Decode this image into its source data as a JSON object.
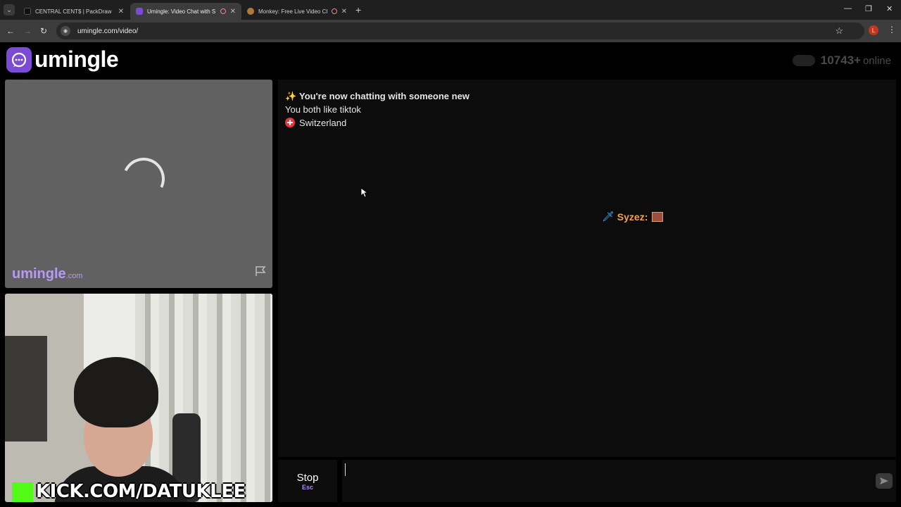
{
  "browser": {
    "tabs": [
      {
        "title": "CENTRAL CENT$ | PackDraw",
        "active": false
      },
      {
        "title": "Umingle: Video Chat with S",
        "active": true
      },
      {
        "title": "Monkey: Free Live Video Ch",
        "active": false
      }
    ],
    "url": "umingle.com/video/",
    "profile_initial": "L"
  },
  "header": {
    "brand": "umingle",
    "online_count": "10743+",
    "online_label": "online"
  },
  "stranger_video": {
    "watermark_main": "umingle",
    "watermark_suffix": ".com"
  },
  "self_video": {
    "overlay_text": "KICK.COM/DATUKLEE"
  },
  "chat": {
    "system_lines": [
      {
        "icon": "✨",
        "text": "You're now chatting with someone new"
      },
      {
        "text": "You both like tiktok"
      },
      {
        "icon": "swiss-flag",
        "text": "Switzerland"
      }
    ],
    "messages": [
      {
        "icon": "🗡",
        "author": "Syzez:"
      }
    ]
  },
  "controls": {
    "stop_label": "Stop",
    "stop_key": "Esc",
    "input_value": ""
  },
  "colors": {
    "accent": "#7b4bd6",
    "author": "#f5a04a",
    "kick_green": "#53fc18"
  }
}
